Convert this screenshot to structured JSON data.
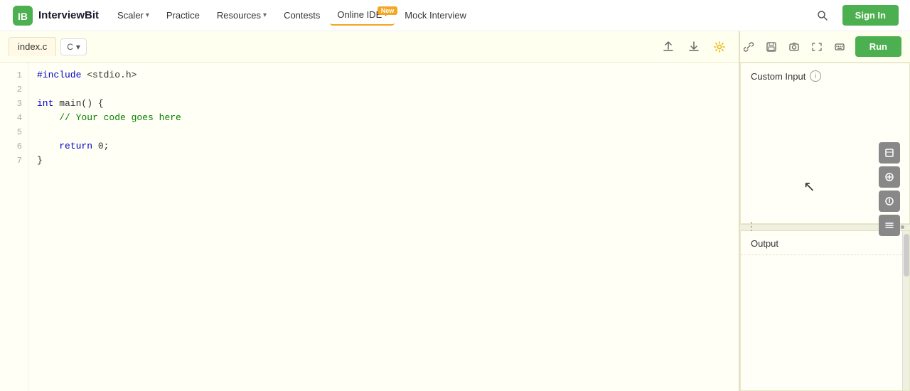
{
  "navbar": {
    "logo_text": "InterviewBit",
    "nav_items": [
      {
        "label": "Scaler",
        "has_chevron": true
      },
      {
        "label": "Practice",
        "has_chevron": false
      },
      {
        "label": "Resources",
        "has_chevron": true
      },
      {
        "label": "Contests",
        "has_chevron": false
      },
      {
        "label": "Online IDE",
        "has_chevron": true,
        "badge": "New",
        "active": true
      },
      {
        "label": "Mock Interview",
        "has_chevron": false
      }
    ],
    "signin_label": "Sign In"
  },
  "editor": {
    "tab_label": "index.c",
    "language": "C",
    "code_lines": [
      {
        "num": 1,
        "text": "#include <stdio.h>"
      },
      {
        "num": 2,
        "text": ""
      },
      {
        "num": 3,
        "text": "int main() {"
      },
      {
        "num": 4,
        "text": "    // Your code goes here"
      },
      {
        "num": 5,
        "text": ""
      },
      {
        "num": 6,
        "text": "    return 0;"
      },
      {
        "num": 7,
        "text": "}"
      }
    ]
  },
  "toolbar": {
    "upload_icon": "⬆",
    "download_icon": "⬇",
    "settings_icon": "⚙",
    "run_label": "Run",
    "link_icon": "🔗",
    "save_icon": "💾",
    "image_icon": "🖼",
    "fullscreen_icon": "⛶",
    "keyboard_icon": "⌨"
  },
  "custom_input": {
    "label": "Custom Input",
    "info_icon": "i"
  },
  "output": {
    "label": "Output"
  },
  "resize": {
    "left_dots": "⋮",
    "right_dots": [
      "•",
      "•",
      "•"
    ]
  }
}
